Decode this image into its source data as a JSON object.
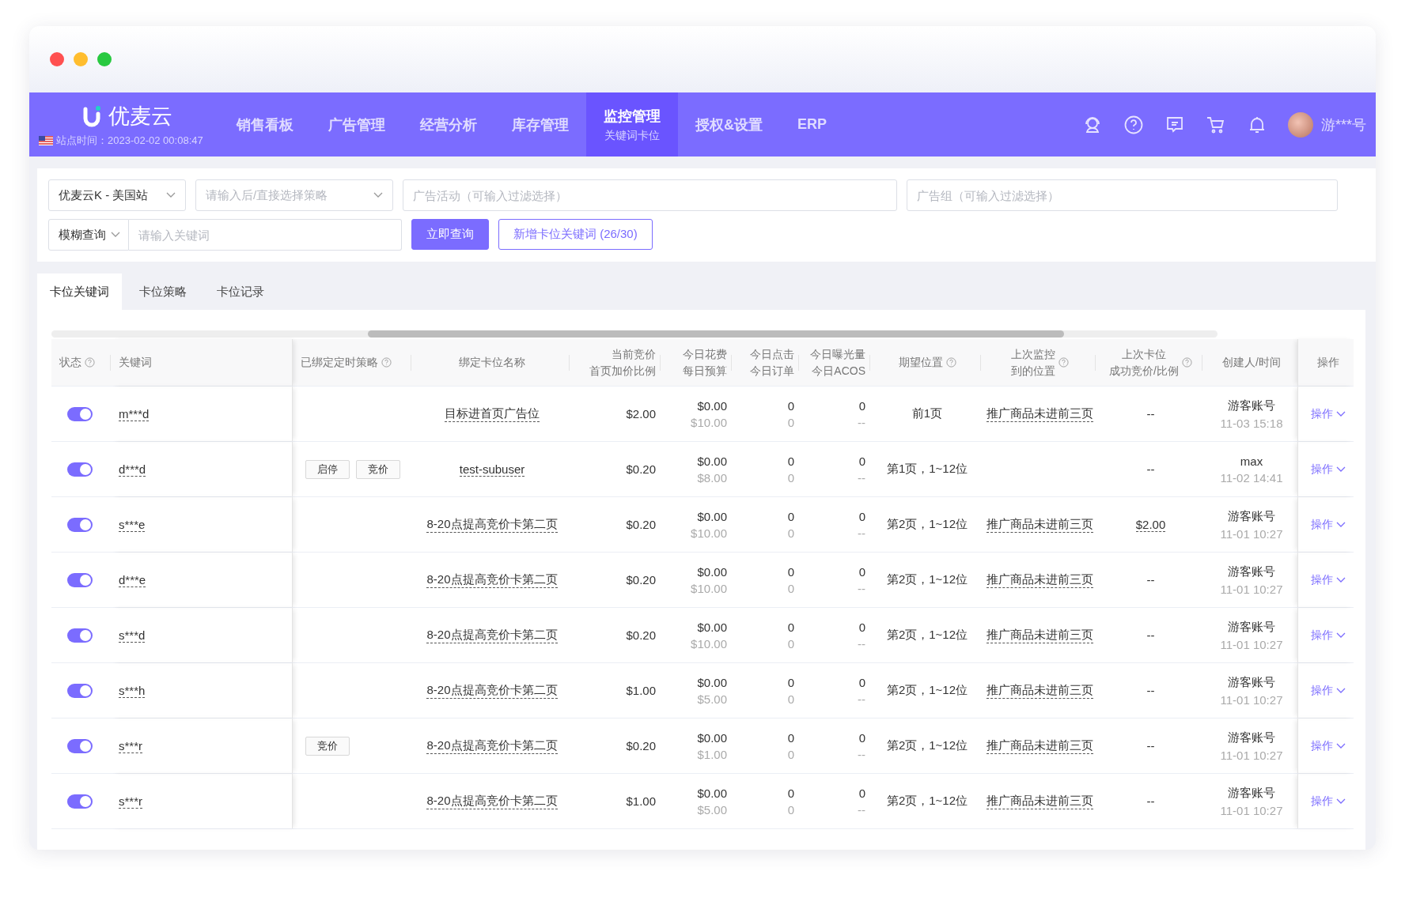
{
  "brand": {
    "name": "优麦云",
    "site_time": "站点时间：2023-02-02 00:08:47"
  },
  "nav": [
    {
      "label": "销售看板",
      "selected": false
    },
    {
      "label": "广告管理",
      "selected": false
    },
    {
      "label": "经营分析",
      "selected": false
    },
    {
      "label": "库存管理",
      "selected": false
    },
    {
      "label": "监控管理",
      "selected": true,
      "subtitle": "关键词卡位"
    },
    {
      "label": "授权&设置",
      "selected": false
    },
    {
      "label": "ERP",
      "selected": false
    }
  ],
  "user": {
    "name": "游***号"
  },
  "filters": {
    "store": {
      "value": "优麦云K - 美国站"
    },
    "strategy": {
      "placeholder": "请输入后/直接选择策略"
    },
    "campaign": {
      "placeholder": "广告活动（可输入过滤选择）"
    },
    "ad_group": {
      "placeholder": "广告组（可输入过滤选择）"
    },
    "match": {
      "value": "模糊查询"
    },
    "keyword": {
      "placeholder": "请输入关键词"
    },
    "search_button": "立即查询",
    "add_button": "新增卡位关键词 (26/30)"
  },
  "tabs": [
    {
      "label": "卡位关键词",
      "selected": true
    },
    {
      "label": "卡位策略",
      "selected": false
    },
    {
      "label": "卡位记录",
      "selected": false
    }
  ],
  "columns": [
    {
      "lines": [
        "状态"
      ],
      "help": true
    },
    {
      "lines": [
        "关键词"
      ],
      "help": false
    },
    {
      "lines": [
        "已绑定定时策略"
      ],
      "help": true
    },
    {
      "lines": [
        "绑定卡位名称"
      ],
      "help": false
    },
    {
      "lines": [
        "当前竞价",
        "首页加价比例"
      ],
      "help": false
    },
    {
      "lines": [
        "今日花费",
        "每日预算"
      ],
      "help": false
    },
    {
      "lines": [
        "今日点击",
        "今日订单"
      ],
      "help": false
    },
    {
      "lines": [
        "今日曝光量",
        "今日ACOS"
      ],
      "help": false
    },
    {
      "lines": [
        "期望位置"
      ],
      "help": true
    },
    {
      "lines": [
        "上次监控",
        "到的位置"
      ],
      "help": true
    },
    {
      "lines": [
        "上次卡位",
        "成功竞价/比例"
      ],
      "help": true
    },
    {
      "lines": [
        "创建人/时间"
      ],
      "help": false
    },
    {
      "lines": [
        "操作"
      ],
      "help": false
    }
  ],
  "rows": [
    {
      "on": true,
      "keyword": "m***d",
      "tags": [],
      "slot": "目标进首页广告位",
      "bid": "$2.00",
      "spend": "$0.00",
      "budget": "$10.00",
      "clicks": "0",
      "orders": "0",
      "impressions": "0",
      "acos": "--",
      "expected": "前1页",
      "last_position": "推广商品未进前三页",
      "last_success": "--",
      "last_success_link": false,
      "creator": "游客账号",
      "time": "11-03 15:18",
      "action": "操作"
    },
    {
      "on": true,
      "keyword": "d***d",
      "tags": [
        "启停",
        "竞价"
      ],
      "slot": "test-subuser",
      "bid": "$0.20",
      "spend": "$0.00",
      "budget": "$8.00",
      "clicks": "0",
      "orders": "0",
      "impressions": "0",
      "acos": "--",
      "expected": "第1页，1~12位",
      "last_success": "--",
      "last_success_link": false,
      "creator": "max",
      "time": "11-02 14:41",
      "action": "操作"
    },
    {
      "on": true,
      "keyword": "s***e",
      "tags": [],
      "slot": "8-20点提高竞价卡第二页",
      "bid": "$0.20",
      "spend": "$0.00",
      "budget": "$10.00",
      "clicks": "0",
      "orders": "0",
      "impressions": "0",
      "acos": "--",
      "expected": "第2页，1~12位",
      "last_position": "推广商品未进前三页",
      "last_success": "$2.00",
      "last_success_link": true,
      "creator": "游客账号",
      "time": "11-01 10:27",
      "action": "操作"
    },
    {
      "on": true,
      "keyword": "d***e",
      "tags": [],
      "slot": "8-20点提高竞价卡第二页",
      "bid": "$0.20",
      "spend": "$0.00",
      "budget": "$10.00",
      "clicks": "0",
      "orders": "0",
      "impressions": "0",
      "acos": "--",
      "expected": "第2页，1~12位",
      "last_position": "推广商品未进前三页",
      "last_success": "--",
      "last_success_link": false,
      "creator": "游客账号",
      "time": "11-01 10:27",
      "action": "操作"
    },
    {
      "on": true,
      "keyword": "s***d",
      "tags": [],
      "slot": "8-20点提高竞价卡第二页",
      "bid": "$0.20",
      "spend": "$0.00",
      "budget": "$10.00",
      "clicks": "0",
      "orders": "0",
      "impressions": "0",
      "acos": "--",
      "expected": "第2页，1~12位",
      "last_position": "推广商品未进前三页",
      "last_success": "--",
      "last_success_link": false,
      "creator": "游客账号",
      "time": "11-01 10:27",
      "action": "操作"
    },
    {
      "on": true,
      "keyword": "s***h",
      "tags": [],
      "slot": "8-20点提高竞价卡第二页",
      "bid": "$1.00",
      "spend": "$0.00",
      "budget": "$5.00",
      "clicks": "0",
      "orders": "0",
      "impressions": "0",
      "acos": "--",
      "expected": "第2页，1~12位",
      "last_position": "推广商品未进前三页",
      "last_success": "--",
      "last_success_link": false,
      "creator": "游客账号",
      "time": "11-01 10:27",
      "action": "操作"
    },
    {
      "on": true,
      "keyword": "s***r",
      "tags": [
        "竞价"
      ],
      "slot": "8-20点提高竞价卡第二页",
      "bid": "$0.20",
      "spend": "$0.00",
      "budget": "$1.00",
      "clicks": "0",
      "orders": "0",
      "impressions": "0",
      "acos": "--",
      "expected": "第2页，1~12位",
      "last_position": "推广商品未进前三页",
      "last_success": "--",
      "last_success_link": false,
      "creator": "游客账号",
      "time": "11-01 10:27",
      "action": "操作"
    },
    {
      "on": true,
      "keyword": "s***r",
      "tags": [],
      "slot": "8-20点提高竞价卡第二页",
      "bid": "$1.00",
      "spend": "$0.00",
      "budget": "$5.00",
      "clicks": "0",
      "orders": "0",
      "impressions": "0",
      "acos": "--",
      "expected": "第2页，1~12位",
      "last_position": "推广商品未进前三页",
      "last_success": "--",
      "last_success_link": false,
      "creator": "游客账号",
      "time": "11-01 10:27",
      "action": "操作"
    }
  ]
}
